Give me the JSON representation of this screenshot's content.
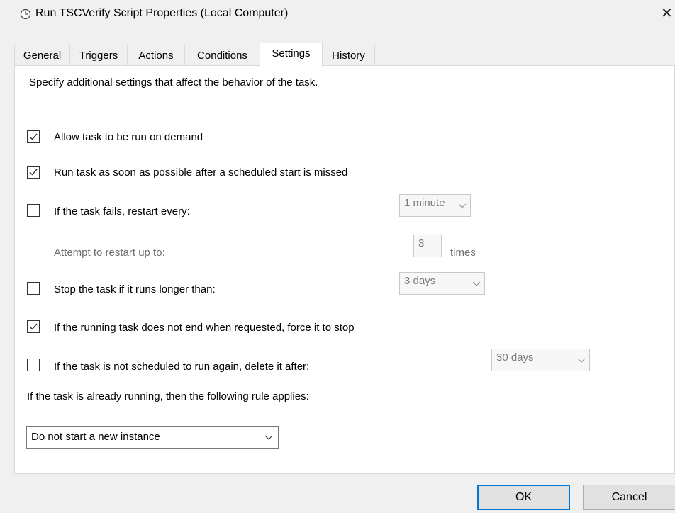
{
  "window": {
    "title": "Run TSCVerify Script Properties (Local Computer)",
    "close_glyph": "✕",
    "icon": "clock-icon"
  },
  "tabs": [
    {
      "label": "General",
      "active": false
    },
    {
      "label": "Triggers",
      "active": false
    },
    {
      "label": "Actions",
      "active": false
    },
    {
      "label": "Conditions",
      "active": false
    },
    {
      "label": "Settings",
      "active": true
    },
    {
      "label": "History",
      "active": false
    }
  ],
  "settings": {
    "intro": "Specify additional settings that affect the behavior of the task.",
    "allow_on_demand": {
      "label": "Allow task to be run on demand",
      "checked": true
    },
    "run_missed": {
      "label": "Run task as soon as possible after a scheduled start is missed",
      "checked": true
    },
    "restart_on_fail": {
      "label": "If the task fails, restart every:",
      "checked": false,
      "interval": "1 minute"
    },
    "restart_attempts": {
      "label": "Attempt to restart up to:",
      "value": "3",
      "suffix": "times"
    },
    "stop_if_longer": {
      "label": "Stop the task if it runs longer than:",
      "checked": false,
      "duration": "3 days"
    },
    "force_stop": {
      "label": "If the running task does not end when requested, force it to stop",
      "checked": true
    },
    "delete_after": {
      "label": "If the task is not scheduled to run again, delete it after:",
      "checked": false,
      "duration": "30 days"
    },
    "rule_label": "If the task is already running, then the following rule applies:",
    "rule_value": "Do not start a new instance"
  },
  "buttons": {
    "ok": "OK",
    "cancel": "Cancel"
  },
  "colors": {
    "accent": "#0078d7",
    "check": "#333333"
  }
}
